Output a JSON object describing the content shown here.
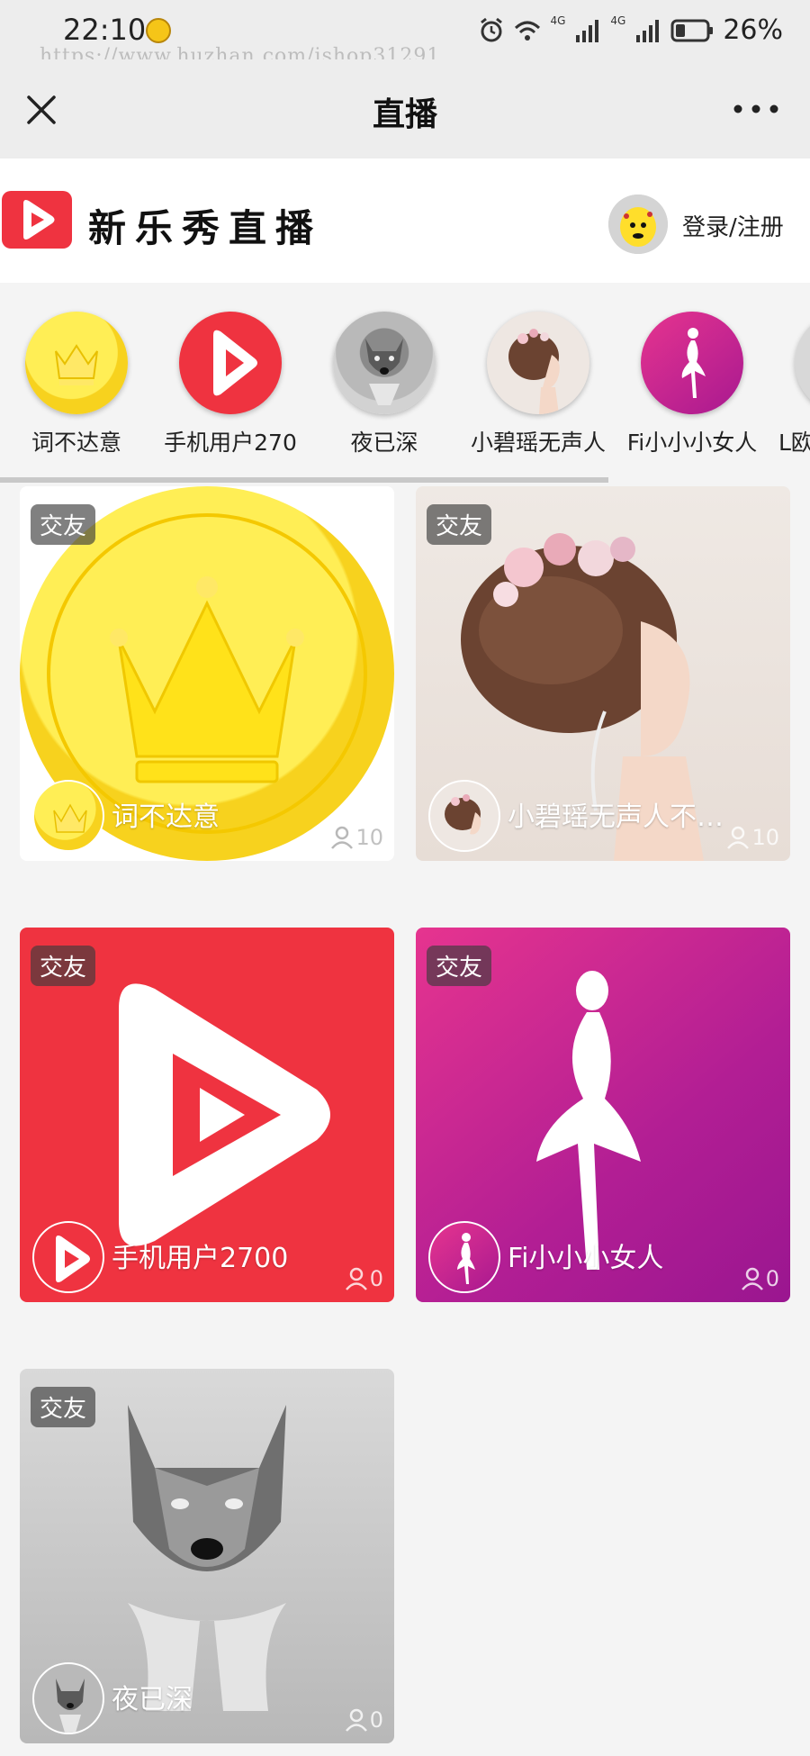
{
  "status_bar": {
    "time": "22:10",
    "watermark": "https://www.huzhan.com/ishop31291",
    "battery_percent": "26%",
    "network_labels": [
      "4G",
      "4G"
    ]
  },
  "nav": {
    "title": "直播"
  },
  "header": {
    "brand_name": "新乐秀直播",
    "login_label": "登录/注册",
    "brand_color": "#ef3340"
  },
  "carousel": [
    {
      "label": "词不达意",
      "avatar": "crown-coin"
    },
    {
      "label": "手机用户270",
      "avatar": "red-play-logo"
    },
    {
      "label": "夜已深",
      "avatar": "wolf"
    },
    {
      "label": "小碧瑶无声人",
      "avatar": "girl-flowers"
    },
    {
      "label": "Fi小小小女人",
      "avatar": "dancer-silhouette"
    },
    {
      "label": "L欧",
      "avatar": "unknown"
    }
  ],
  "cards": [
    {
      "tag": "交友",
      "name": "词不达意",
      "viewers": "10",
      "art": "crown-coin"
    },
    {
      "tag": "交友",
      "name": "小碧瑶无声人不…",
      "viewers": "10",
      "art": "girl-flowers"
    },
    {
      "tag": "交友",
      "name": "手机用户2700",
      "viewers": "0",
      "art": "red-play-logo"
    },
    {
      "tag": "交友",
      "name": "Fi小小小女人",
      "viewers": "0",
      "art": "dancer-silhouette"
    },
    {
      "tag": "交友",
      "name": "夜已深",
      "viewers": "0",
      "art": "wolf"
    }
  ],
  "colors": {
    "accent_red": "#ef3340",
    "accent_magenta": "#b21e94",
    "coin_yellow": "#f7d21e"
  }
}
